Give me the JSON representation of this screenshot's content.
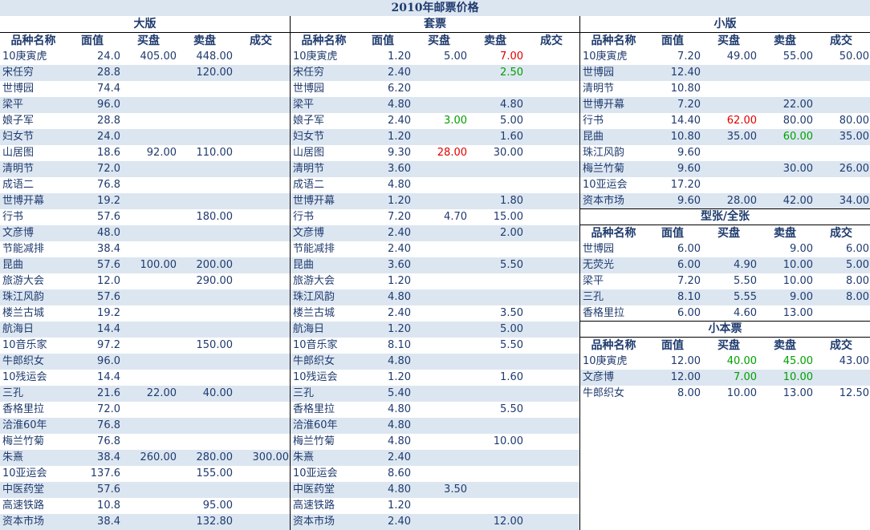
{
  "title": "2010年邮票价格",
  "columns": [
    "品种名称",
    "面值",
    "买盘",
    "卖盘",
    "成交"
  ],
  "sections": {
    "large": {
      "heading": "大版",
      "rows": [
        [
          "10庚寅虎",
          "24.0",
          "405.00",
          "448.00",
          ""
        ],
        [
          "宋任穷",
          "28.8",
          "",
          "120.00",
          ""
        ],
        [
          "世博园",
          "74.4",
          "",
          "",
          ""
        ],
        [
          "梁平",
          "96.0",
          "",
          "",
          ""
        ],
        [
          "娘子军",
          "28.8",
          "",
          "",
          ""
        ],
        [
          "妇女节",
          "24.0",
          "",
          "",
          ""
        ],
        [
          "山居图",
          "18.6",
          "92.00",
          "110.00",
          ""
        ],
        [
          "清明节",
          "72.0",
          "",
          "",
          ""
        ],
        [
          "成语二",
          "76.8",
          "",
          "",
          ""
        ],
        [
          "世博开幕",
          "19.2",
          "",
          "",
          ""
        ],
        [
          "行书",
          "57.6",
          "",
          "180.00",
          ""
        ],
        [
          "文彦博",
          "48.0",
          "",
          "",
          ""
        ],
        [
          "节能减排",
          "38.4",
          "",
          "",
          ""
        ],
        [
          "昆曲",
          "57.6",
          "100.00",
          "200.00",
          ""
        ],
        [
          "旅游大会",
          "12.0",
          "",
          "290.00",
          ""
        ],
        [
          "珠江风韵",
          "57.6",
          "",
          "",
          ""
        ],
        [
          "楼兰古城",
          "19.2",
          "",
          "",
          ""
        ],
        [
          "航海日",
          "14.4",
          "",
          "",
          ""
        ],
        [
          "10音乐家",
          "97.2",
          "",
          "150.00",
          ""
        ],
        [
          "牛郎织女",
          "96.0",
          "",
          "",
          ""
        ],
        [
          "10残运会",
          "14.4",
          "",
          "",
          ""
        ],
        [
          "三孔",
          "21.6",
          "22.00",
          "40.00",
          ""
        ],
        [
          "香格里拉",
          "72.0",
          "",
          "",
          ""
        ],
        [
          "洽淮60年",
          "76.8",
          "",
          "",
          ""
        ],
        [
          "梅兰竹菊",
          "76.8",
          "",
          "",
          ""
        ],
        [
          "朱熹",
          "38.4",
          "260.00",
          "280.00",
          "300.00"
        ],
        [
          "10亚运会",
          "137.6",
          "",
          "155.00",
          ""
        ],
        [
          "中医药堂",
          "57.6",
          "",
          "",
          ""
        ],
        [
          "高速铁路",
          "10.8",
          "",
          "95.00",
          ""
        ],
        [
          "资本市场",
          "38.4",
          "",
          "132.80",
          ""
        ]
      ]
    },
    "set": {
      "heading": "套票",
      "rows": [
        [
          "10庚寅虎",
          "1.20",
          "5.00",
          "7.00",
          ""
        ],
        [
          "宋任穷",
          "2.40",
          "",
          "2.50",
          ""
        ],
        [
          "世博园",
          "6.20",
          "",
          "",
          ""
        ],
        [
          "梁平",
          "4.80",
          "",
          "4.80",
          ""
        ],
        [
          "娘子军",
          "2.40",
          "3.00",
          "5.00",
          ""
        ],
        [
          "妇女节",
          "1.20",
          "",
          "1.60",
          ""
        ],
        [
          "山居图",
          "9.30",
          "28.00",
          "30.00",
          ""
        ],
        [
          "清明节",
          "3.60",
          "",
          "",
          ""
        ],
        [
          "成语二",
          "4.80",
          "",
          "",
          ""
        ],
        [
          "世博开幕",
          "1.20",
          "",
          "1.80",
          ""
        ],
        [
          "行书",
          "7.20",
          "4.70",
          "15.00",
          ""
        ],
        [
          "文彦博",
          "2.40",
          "",
          "2.00",
          ""
        ],
        [
          "节能减排",
          "2.40",
          "",
          "",
          ""
        ],
        [
          "昆曲",
          "3.60",
          "",
          "5.50",
          ""
        ],
        [
          "旅游大会",
          "1.20",
          "",
          "",
          ""
        ],
        [
          "珠江风韵",
          "4.80",
          "",
          "",
          ""
        ],
        [
          "楼兰古城",
          "2.40",
          "",
          "3.50",
          ""
        ],
        [
          "航海日",
          "1.20",
          "",
          "5.00",
          ""
        ],
        [
          "10音乐家",
          "8.10",
          "",
          "5.50",
          ""
        ],
        [
          "牛郎织女",
          "4.80",
          "",
          "",
          ""
        ],
        [
          "10残运会",
          "1.20",
          "",
          "1.60",
          ""
        ],
        [
          "三孔",
          "5.40",
          "",
          "",
          ""
        ],
        [
          "香格里拉",
          "4.80",
          "",
          "5.50",
          ""
        ],
        [
          "洽淮60年",
          "4.80",
          "",
          "",
          ""
        ],
        [
          "梅兰竹菊",
          "4.80",
          "",
          "10.00",
          ""
        ],
        [
          "朱熹",
          "2.40",
          "",
          "",
          ""
        ],
        [
          "10亚运会",
          "8.60",
          "",
          "",
          ""
        ],
        [
          "中医药堂",
          "4.80",
          "3.50",
          "",
          ""
        ],
        [
          "高速铁路",
          "1.20",
          "",
          "",
          ""
        ],
        [
          "资本市场",
          "2.40",
          "",
          "12.00",
          ""
        ]
      ],
      "highlights": [
        {
          "row": 0,
          "col": 3,
          "color": "red"
        },
        {
          "row": 1,
          "col": 3,
          "color": "green"
        },
        {
          "row": 4,
          "col": 2,
          "color": "green"
        },
        {
          "row": 6,
          "col": 2,
          "color": "red"
        }
      ]
    },
    "small": {
      "heading": "小版",
      "rows": [
        [
          "10庚寅虎",
          "7.20",
          "49.00",
          "55.00",
          "50.00"
        ],
        [
          "世博园",
          "12.40",
          "",
          "",
          ""
        ],
        [
          "清明节",
          "10.80",
          "",
          "",
          ""
        ],
        [
          "世博开幕",
          "7.20",
          "",
          "22.00",
          ""
        ],
        [
          "行书",
          "14.40",
          "62.00",
          "80.00",
          "80.00"
        ],
        [
          "昆曲",
          "10.80",
          "35.00",
          "60.00",
          "35.00"
        ],
        [
          "珠江风韵",
          "9.60",
          "",
          "",
          ""
        ],
        [
          "梅兰竹菊",
          "9.60",
          "",
          "30.00",
          "26.00"
        ],
        [
          "10亚运会",
          "17.20",
          "",
          "",
          ""
        ],
        [
          "资本市场",
          "9.60",
          "28.00",
          "42.00",
          "34.00"
        ]
      ],
      "highlights": [
        {
          "row": 4,
          "col": 2,
          "color": "red"
        },
        {
          "row": 5,
          "col": 3,
          "color": "green"
        }
      ]
    },
    "full_sheet": {
      "heading": "型张/全张",
      "rows": [
        [
          "世博园",
          "6.00",
          "",
          "9.00",
          "6.00"
        ],
        [
          "无荧光",
          "6.00",
          "4.90",
          "10.00",
          "5.00"
        ],
        [
          "梁平",
          "7.20",
          "5.50",
          "10.00",
          "8.00"
        ],
        [
          "三孔",
          "8.10",
          "5.55",
          "9.00",
          "8.00"
        ],
        [
          "香格里拉",
          "6.00",
          "4.60",
          "13.00",
          ""
        ]
      ]
    },
    "booklet": {
      "heading": "小本票",
      "rows": [
        [
          "10庚寅虎",
          "12.00",
          "40.00",
          "45.00",
          "43.00"
        ],
        [
          "文彦博",
          "12.00",
          "7.00",
          "10.00",
          ""
        ],
        [
          "牛郎织女",
          "8.00",
          "10.00",
          "13.00",
          "12.50"
        ]
      ],
      "highlights": [
        {
          "row": 0,
          "col": 2,
          "color": "green"
        },
        {
          "row": 0,
          "col": 3,
          "color": "green"
        },
        {
          "row": 1,
          "col": 2,
          "color": "green"
        },
        {
          "row": 1,
          "col": 3,
          "color": "green"
        }
      ]
    }
  }
}
